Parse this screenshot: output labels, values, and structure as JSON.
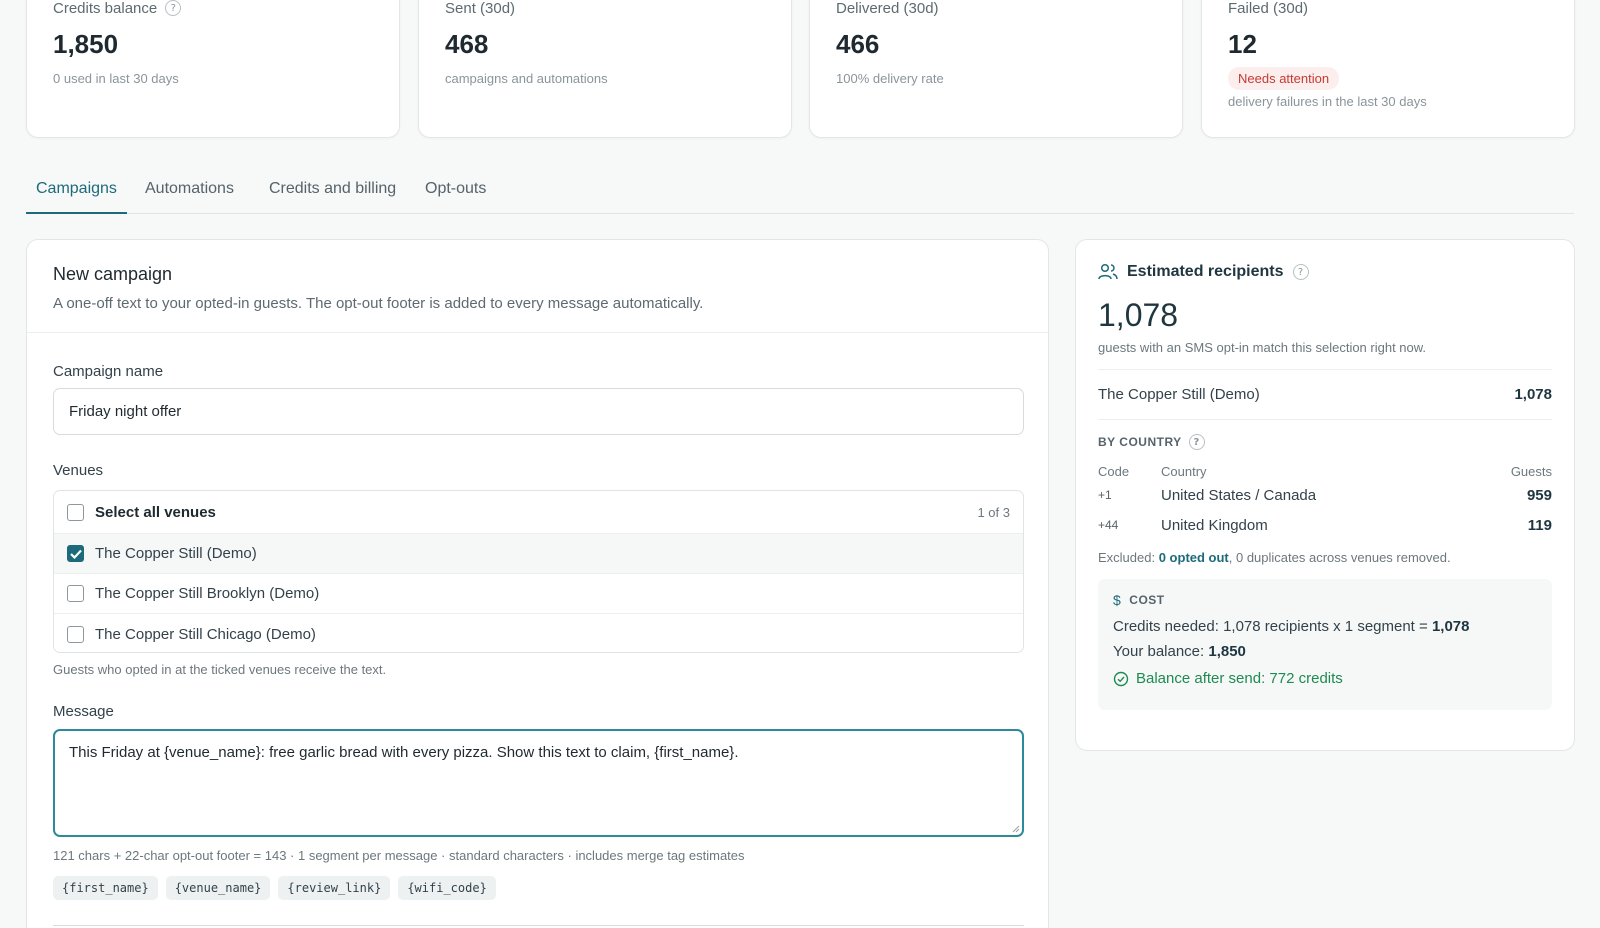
{
  "stats": [
    {
      "label": "Credits balance",
      "value": "1,850",
      "sub": "0 used in last 30 days",
      "has_help": true
    },
    {
      "label": "Sent (30d)",
      "value": "468",
      "sub": "campaigns and automations"
    },
    {
      "label": "Delivered (30d)",
      "value": "466",
      "sub": "100% delivery rate"
    },
    {
      "label": "Failed (30d)",
      "value": "12",
      "badge": "Needs attention",
      "sub": "delivery failures in the last 30 days"
    }
  ],
  "tabs": [
    {
      "label": "Campaigns",
      "active": true
    },
    {
      "label": "Automations",
      "active": false
    },
    {
      "label": "Credits and billing",
      "active": false
    },
    {
      "label": "Opt-outs",
      "active": false
    }
  ],
  "campaign": {
    "title": "New campaign",
    "description": "A one-off text to your opted-in guests. The opt-out footer is added to every message automatically.",
    "name_label": "Campaign name",
    "name_value": "Friday night offer",
    "venues_label": "Venues",
    "select_all_label": "Select all venues",
    "venue_count": "1 of 3",
    "venues": [
      {
        "name": "The Copper Still (Demo)",
        "checked": true
      },
      {
        "name": "The Copper Still Brooklyn (Demo)",
        "checked": false
      },
      {
        "name": "The Copper Still Chicago (Demo)",
        "checked": false
      }
    ],
    "venues_hint": "Guests who opted in at the ticked venues receive the text.",
    "message_label": "Message",
    "message_value": "This Friday at {venue_name}: free garlic bread with every pizza. Show this text to claim, {first_name}.",
    "message_stats": "121 chars + 22-char opt-out footer = 143 · 1 segment per message · standard characters · includes merge tag estimates",
    "merge_tags": [
      "{first_name}",
      "{venue_name}",
      "{review_link}",
      "{wifi_code}"
    ]
  },
  "recipients": {
    "title": "Estimated recipients",
    "icon": "users-icon",
    "count": "1,078",
    "subtitle": "guests with an SMS opt-in match this selection right now.",
    "venue_name": "The Copper Still (Demo)",
    "venue_count": "1,078",
    "by_country_label": "BY COUNTRY",
    "columns": {
      "code": "Code",
      "country": "Country",
      "guests": "Guests"
    },
    "countries": [
      {
        "code": "+1",
        "country": "United States / Canada",
        "guests": "959"
      },
      {
        "code": "+44",
        "country": "United Kingdom",
        "guests": "119"
      }
    ],
    "excluded_prefix": "Excluded:",
    "excluded_link": "0 opted out",
    "excluded_suffix": ", 0 duplicates across venues removed.",
    "cost_label": "COST",
    "credits_needed_prefix": "Credits needed: 1,078 recipients x 1 segment =",
    "credits_needed_value": "1,078",
    "balance_prefix": "Your balance:",
    "balance_value": "1,850",
    "balance_after": "Balance after send: 772 credits"
  },
  "colors": {
    "accent": "#1d6b7a",
    "success": "#1f8a52",
    "danger": "#c53a34"
  }
}
